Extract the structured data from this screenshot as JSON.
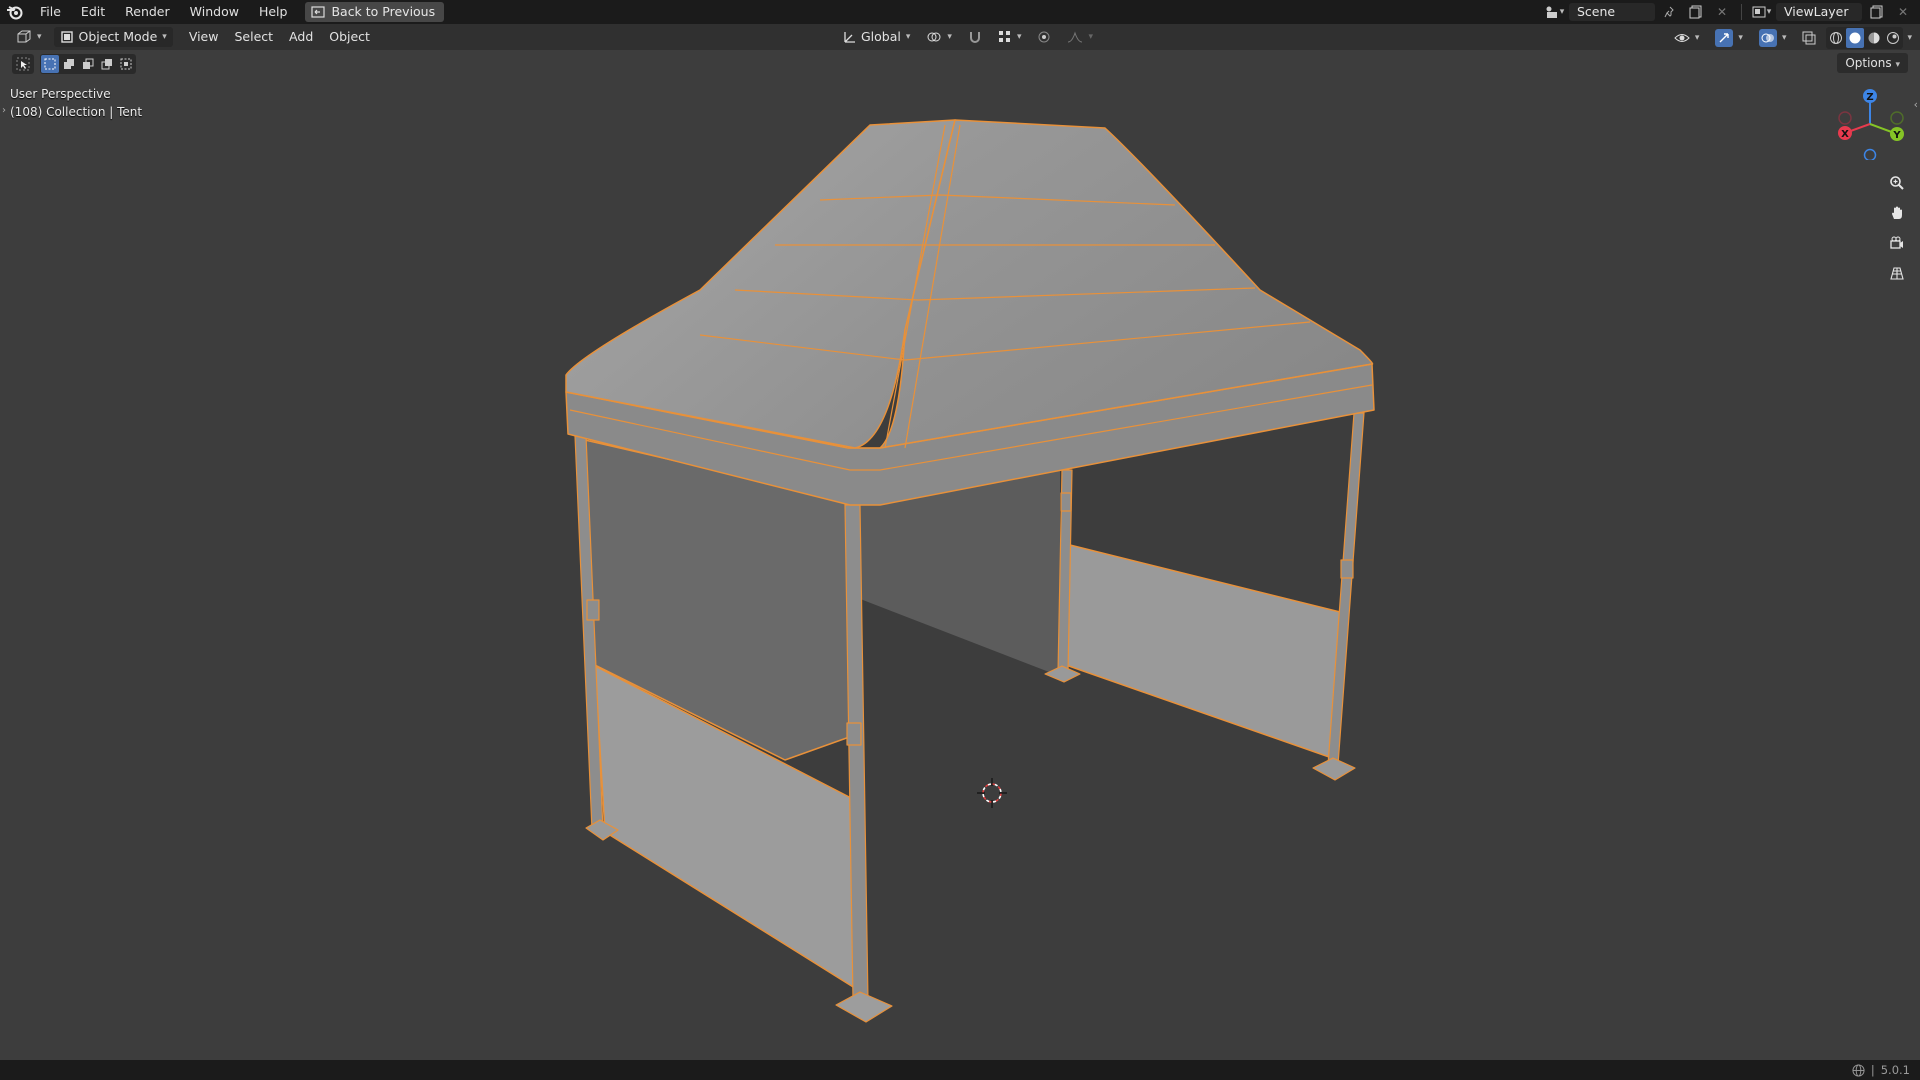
{
  "menu": {
    "items": [
      "File",
      "Edit",
      "Render",
      "Window",
      "Help"
    ],
    "back_button": "Back to Previous"
  },
  "top_right": {
    "scene_label": "Scene",
    "view_layer_label": "ViewLayer"
  },
  "header": {
    "mode": "Object Mode",
    "menus": [
      "View",
      "Select",
      "Add",
      "Object"
    ],
    "transform_orientation": "Global",
    "options_label": "Options"
  },
  "viewport": {
    "perspective_label": "User Perspective",
    "collection_label": "(108) Collection | Tent"
  },
  "gizmo": {
    "axes": [
      "Z",
      "X",
      "Y"
    ]
  },
  "status": {
    "version": "5.0.1"
  },
  "colors": {
    "selection_outline": "#e8913a",
    "active_blue": "#4772b3",
    "axis_x": "#e83a4e",
    "axis_y": "#85c426",
    "axis_z": "#3d85e6"
  }
}
